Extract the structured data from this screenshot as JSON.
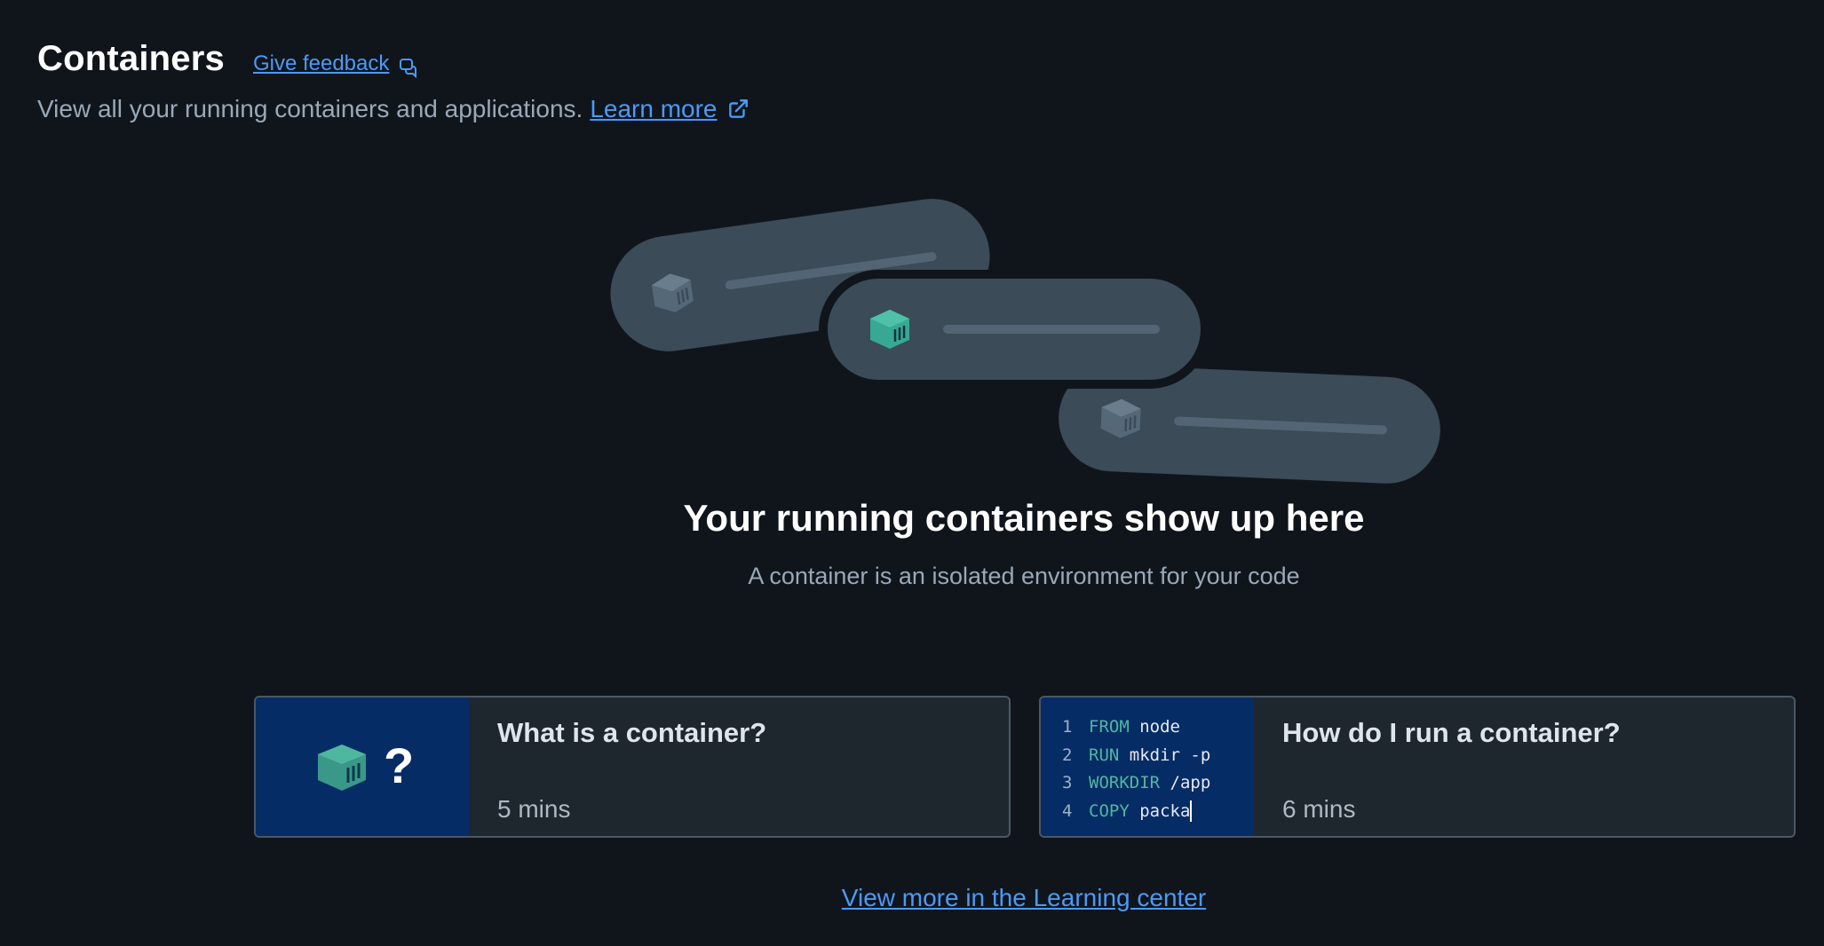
{
  "header": {
    "title": "Containers",
    "feedback_label": "Give feedback",
    "subtitle": "View all your running containers and applications.",
    "learn_more_label": "Learn more"
  },
  "empty_state": {
    "title": "Your running containers show up here",
    "subtitle": "A container is an isolated environment for your code"
  },
  "cards": [
    {
      "title": "What is a container?",
      "duration": "5 mins",
      "thumb_symbol": "?"
    },
    {
      "title": "How do I run a container?",
      "duration": "6 mins",
      "code": [
        {
          "num": "1",
          "kw": "FROM",
          "rest": " node"
        },
        {
          "num": "2",
          "kw": "RUN",
          "rest": " mkdir -p"
        },
        {
          "num": "3",
          "kw": "WORKDIR",
          "rest": " /app"
        },
        {
          "num": "4",
          "kw": "COPY",
          "rest": " packa"
        }
      ]
    }
  ],
  "learning_center_label": "View more in the Learning center",
  "colors": {
    "background": "#10151c",
    "link": "#4a9af8",
    "accent_teal": "#4fc1a9",
    "card_thumb": "#062c66",
    "card_bg": "#1e272e"
  },
  "icons": {
    "feedback": "feedback-icon",
    "external": "external-link-icon",
    "container": "container-cube-icon"
  }
}
